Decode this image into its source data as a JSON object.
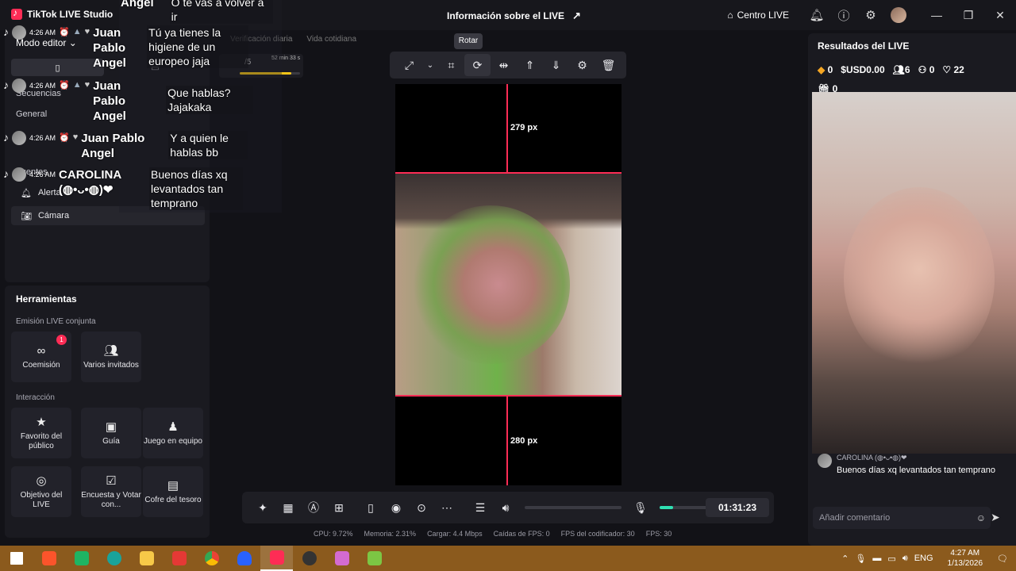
{
  "app": {
    "title": "TikTok LIVE Studio",
    "live_info": "Información sobre el LIVE",
    "share_icon": "share-icon",
    "centro": "Centro LIVE"
  },
  "left": {
    "modo_editor": "Modo editor",
    "secuencias": "Secuencias",
    "general": "General",
    "fuentes": "Fuentes",
    "alerta": "Alerta",
    "camara": "Cámara"
  },
  "tags": {
    "tag1": "Verificación diaria",
    "tag2": "Vida cotidiana",
    "task_count": "/5",
    "task_time": "52 min 33 s"
  },
  "chat": [
    {
      "time": "4:26 AM",
      "name": "Juan Pablo Angel",
      "text": "Tú ya tienes la higiene de un europeo jaja"
    },
    {
      "time": "4:26 AM",
      "name": "Juan Pablo Angel",
      "text": "Que hablas? Jajakaka"
    },
    {
      "time": "4:26 AM",
      "name": "Juan Pablo Angel",
      "text": "Y a quien le hablas bb"
    },
    {
      "time": "4:26 AM",
      "name": "CAROLINA (◍•ᴗ•◍)❤",
      "text": "Buenos días xq levantados tan temprano"
    }
  ],
  "chat_top_fragment": {
    "name": "Angel",
    "text": "O te vas a volver a ir"
  },
  "toolbar": {
    "tooltip": "Rotar"
  },
  "canvas": {
    "top_gap": "279 px",
    "bottom_gap": "280 px"
  },
  "bottom": {
    "timer": "01:31:23",
    "mic_level": 0.18
  },
  "stats": {
    "cpu": "CPU: 9.72%",
    "mem": "Memoria: 2.31%",
    "upload": "Cargar: 4.4 Mbps",
    "fps_drop": "Caídas de FPS: 0",
    "enc_fps": "FPS del codificador: 30",
    "fps": "FPS: 30"
  },
  "tools": {
    "title": "Herramientas",
    "sub_joint": "Emisión LIVE conjunta",
    "sub_interaction": "Interacción",
    "items": [
      {
        "label": "Coemisión",
        "icon": "link-icon",
        "badge": "1"
      },
      {
        "label": "Varios invitados",
        "icon": "users-icon"
      },
      {
        "label": "Favorito del público",
        "icon": "star-user-icon"
      },
      {
        "label": "Guía",
        "icon": "guide-icon"
      },
      {
        "label": "Juego en equipo",
        "icon": "game-icon"
      },
      {
        "label": "Objetivo del LIVE",
        "icon": "target-icon"
      },
      {
        "label": "Encuesta y Votar con...",
        "icon": "poll-icon"
      },
      {
        "label": "Cofre del tesoro",
        "icon": "chest-icon"
      }
    ]
  },
  "results": {
    "title": "Resultados del LIVE",
    "diamonds": "0",
    "usd": "USD0.00",
    "viewers": "6",
    "followers": "0",
    "likes": "22",
    "gifts": "0",
    "comment_name": "CAROLINA (◍•ᴗ•◍)❤",
    "comment_text": "Buenos días xq levantados tan temprano",
    "input_placeholder": "Añadir comentario"
  },
  "tray": {
    "lang": "ENG",
    "time": "4:27 AM",
    "date": "1/13/2026"
  }
}
